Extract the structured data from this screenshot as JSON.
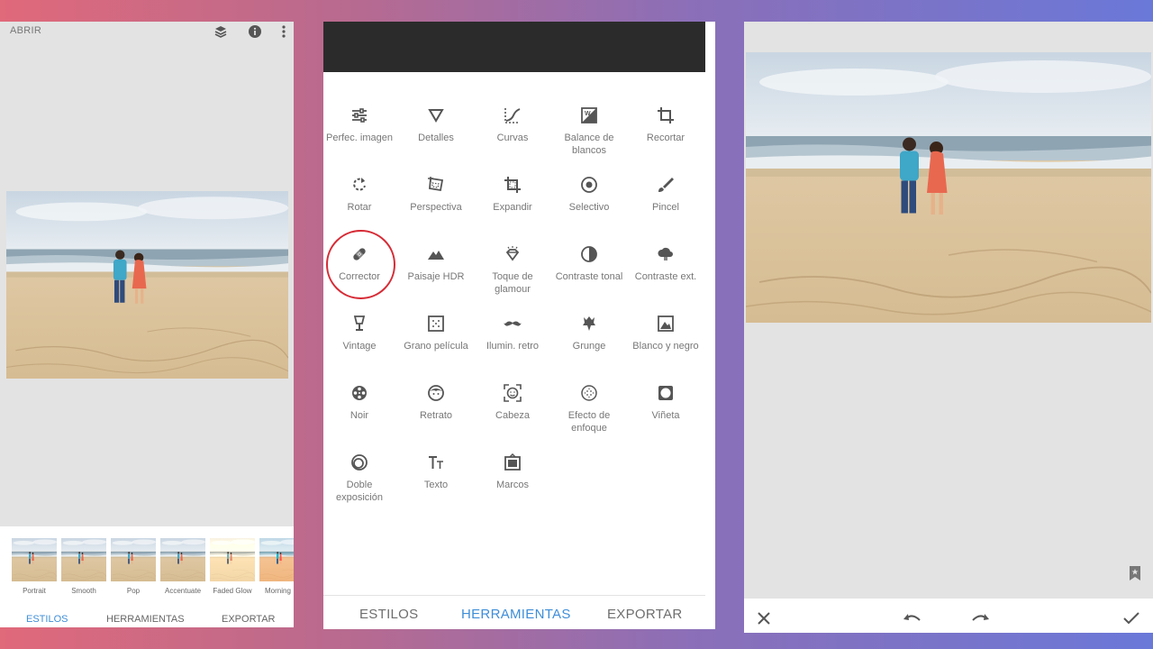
{
  "left_panel": {
    "open_label": "ABRIR",
    "icons": [
      "layers-icon",
      "info-icon",
      "more-vert-icon"
    ],
    "styles": [
      {
        "label": "Portrait"
      },
      {
        "label": "Smooth"
      },
      {
        "label": "Pop"
      },
      {
        "label": "Accentuate"
      },
      {
        "label": "Faded Glow"
      },
      {
        "label": "Morning"
      }
    ],
    "tabs": [
      {
        "label": "ESTILOS",
        "active": true
      },
      {
        "label": "HERRAMIENTAS",
        "active": false
      },
      {
        "label": "EXPORTAR",
        "active": false
      }
    ]
  },
  "tools_panel": {
    "tools": [
      {
        "label": "Perfec. imagen",
        "icon": "tune-icon"
      },
      {
        "label": "Detalles",
        "icon": "triangle-down-icon"
      },
      {
        "label": "Curvas",
        "icon": "curves-icon"
      },
      {
        "label": "Balance de blancos",
        "icon": "white-balance-icon"
      },
      {
        "label": "Recortar",
        "icon": "crop-icon"
      },
      {
        "label": "Rotar",
        "icon": "rotate-icon"
      },
      {
        "label": "Perspectiva",
        "icon": "perspective-icon"
      },
      {
        "label": "Expandir",
        "icon": "expand-icon"
      },
      {
        "label": "Selectivo",
        "icon": "selective-icon"
      },
      {
        "label": "Pincel",
        "icon": "brush-icon"
      },
      {
        "label": "Corrector",
        "icon": "healing-icon"
      },
      {
        "label": "Paisaje HDR",
        "icon": "mountain-icon"
      },
      {
        "label": "Toque de glamour",
        "icon": "diamond-icon"
      },
      {
        "label": "Contraste tonal",
        "icon": "contrast-icon"
      },
      {
        "label": "Contraste ext.",
        "icon": "cloud-icon"
      },
      {
        "label": "Vintage",
        "icon": "lamp-icon"
      },
      {
        "label": "Grano película",
        "icon": "grain-icon"
      },
      {
        "label": "Ilumin. retro",
        "icon": "mustache-icon"
      },
      {
        "label": "Grunge",
        "icon": "grunge-icon"
      },
      {
        "label": "Blanco y negro",
        "icon": "black-white-icon"
      },
      {
        "label": "Noir",
        "icon": "film-reel-icon"
      },
      {
        "label": "Retrato",
        "icon": "face-icon"
      },
      {
        "label": "Cabeza",
        "icon": "face-frame-icon"
      },
      {
        "label": "Efecto de enfoque",
        "icon": "focus-icon"
      },
      {
        "label": "Viñeta",
        "icon": "vignette-icon"
      },
      {
        "label": "Doble exposición",
        "icon": "double-exposure-icon"
      },
      {
        "label": "Texto",
        "icon": "text-icon"
      },
      {
        "label": "Marcos",
        "icon": "frames-icon"
      }
    ],
    "highlighted_tool": "Corrector",
    "tabs": [
      {
        "label": "ESTILOS",
        "active": false
      },
      {
        "label": "HERRAMIENTAS",
        "active": true
      },
      {
        "label": "EXPORTAR",
        "active": false
      }
    ]
  },
  "right_panel": {
    "bottom_icons": [
      "close-icon",
      "undo-icon",
      "redo-icon",
      "check-icon"
    ],
    "side_icon": "bookmark-icon"
  },
  "colors": {
    "accent": "#3e8ed8",
    "highlight_ring": "#d62b35",
    "header_dark": "#2b2b2b",
    "panel_grey": "#e3e3e3"
  }
}
